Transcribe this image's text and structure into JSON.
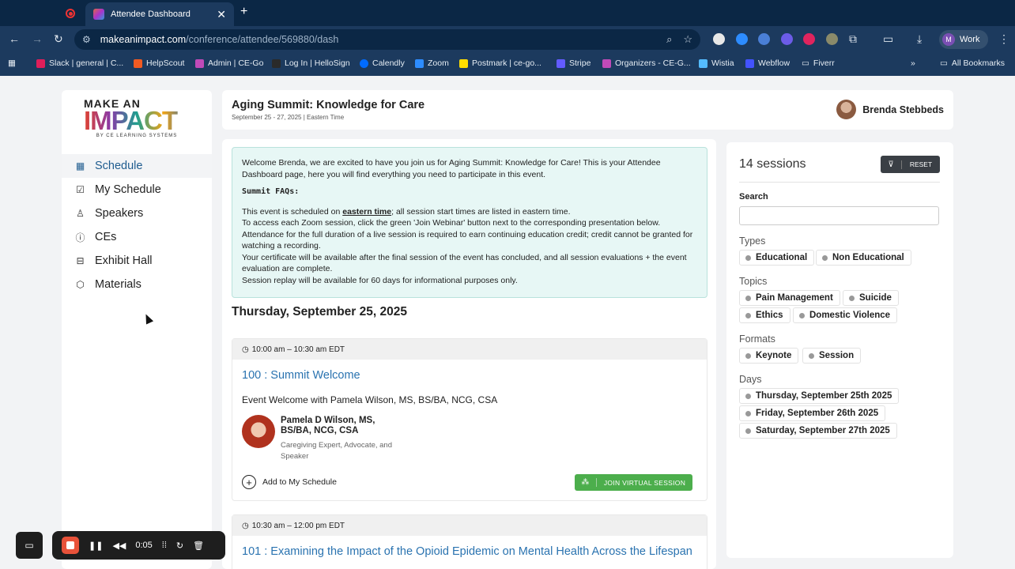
{
  "browser": {
    "tab_title": "Attendee Dashboard",
    "url_host": "makeanimpact.com",
    "url_path": "/conference/attendee/569880/dash",
    "profile_initial": "M",
    "profile_label": "Work",
    "bookmarks": [
      "Slack | general | C...",
      "HelpScout",
      "Admin | CE-Go",
      "Log In | HelloSign",
      "Calendly",
      "Zoom",
      "Postmark | ce-go...",
      "Stripe",
      "Organizers - CE-G...",
      "Wistia",
      "Webflow",
      "Fiverr"
    ],
    "all_bookmarks": "All Bookmarks"
  },
  "logo": {
    "make": "MAKE AN",
    "impact": "IMPACT",
    "sub": "BY CE LEARNING SYSTEMS"
  },
  "nav": [
    "Schedule",
    "My Schedule",
    "Speakers",
    "CEs",
    "Exhibit Hall",
    "Materials"
  ],
  "header": {
    "title": "Aging Summit: Knowledge for Care",
    "dates": "September 25 - 27, 2025 | Eastern Time",
    "user_name": "Brenda Stebbeds"
  },
  "welcome": {
    "intro": "Welcome Brenda, we are excited to have you join us for Aging Summit: Knowledge for Care! This is your Attendee Dashboard page, here you will find everything you need to participate in this event.",
    "faq_heading": "Summit FAQs:",
    "line1_a": "This event is scheduled on ",
    "line1_u": "eastern time",
    "line1_b": "; all session start times are listed in eastern time.",
    "line2": "To access each Zoom session, click the green 'Join Webinar' button next to the corresponding presentation below.",
    "line3": "Attendance for the full duration of a live session is required to earn continuing education credit; credit cannot be granted for watching a recording.",
    "line4": "Your certificate will be available after the final session of the event has concluded, and all session evaluations + the event evaluation are complete.",
    "line5": "Session replay will be available for 60 days for informational purposes only."
  },
  "day_heading": "Thursday, September 25, 2025",
  "sessions": [
    {
      "time": "10:00 am – 10:30 am EDT",
      "title": "100 : Summit Welcome",
      "description": "Event Welcome with Pamela Wilson, MS, BS/BA, NCG, CSA",
      "speaker": "Pamela D Wilson, MS, BS/BA, NCG, CSA",
      "role": "Caregiving Expert, Advocate, and Speaker",
      "add_label": "Add to My Schedule",
      "join_label": "JOIN VIRTUAL SESSION"
    },
    {
      "time": "10:30 am – 12:00 pm EDT",
      "title": "101 : Examining the Impact of the Opioid Epidemic on Mental Health Across the Lifespan"
    }
  ],
  "filters": {
    "count": "14 sessions",
    "reset": "RESET",
    "search_label": "Search",
    "search_value": "",
    "types_label": "Types",
    "types": [
      "Educational",
      "Non Educational"
    ],
    "topics_label": "Topics",
    "topics": [
      "Pain Management",
      "Suicide",
      "Ethics",
      "Domestic Violence"
    ],
    "formats_label": "Formats",
    "formats": [
      "Keynote",
      "Session"
    ],
    "days_label": "Days",
    "days": [
      "Thursday, September 25th 2025",
      "Friday, September 26th 2025",
      "Saturday, September 27th 2025"
    ]
  },
  "recorder": {
    "elapsed": "0:05"
  }
}
